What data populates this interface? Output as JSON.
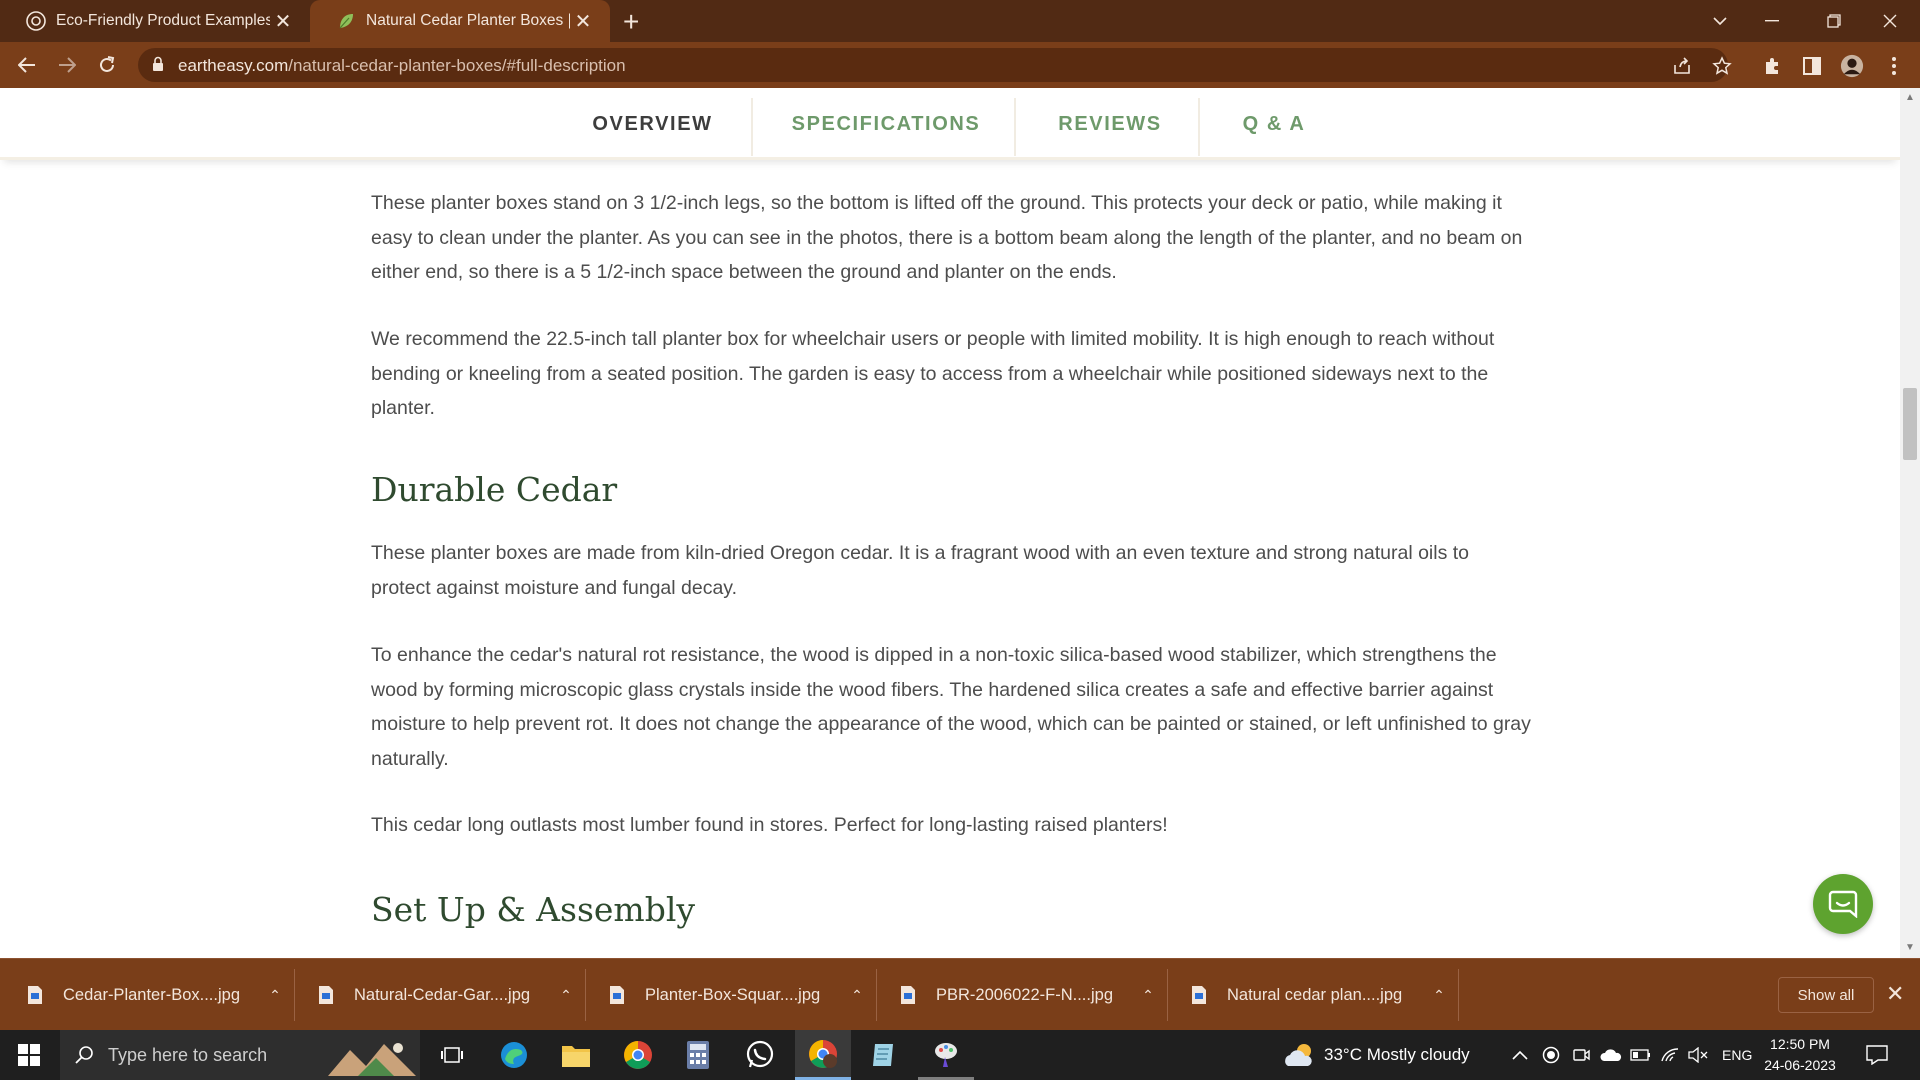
{
  "browser": {
    "tabs": [
      {
        "title": "Eco-Friendly Product Examples",
        "active": false
      },
      {
        "title": "Natural Cedar Planter Boxes | Ear",
        "active": true
      }
    ],
    "new_tab_symbol": "+",
    "close_symbol": "✕",
    "url_domain": "eartheasy.com",
    "url_path": "/natural-cedar-planter-boxes/#full-description"
  },
  "subnav": {
    "tabs": [
      {
        "label": "OVERVIEW",
        "active": true
      },
      {
        "label": "SPECIFICATIONS",
        "active": false
      },
      {
        "label": "REVIEWS",
        "active": false
      },
      {
        "label": "Q & A",
        "active": false
      }
    ]
  },
  "content": {
    "para1": "These planter boxes stand on 3 1/2-inch legs, so the bottom is lifted off the ground. This protects your deck or patio, while making it easy to clean under the planter. As you can see in the photos, there is a bottom beam along the length of the planter, and no beam on either end, so there is a 5 1/2-inch space between the ground and planter on the ends.",
    "para2": "We recommend the 22.5-inch tall planter box for wheelchair users or people with limited mobility. It is high enough to reach without bending or kneeling from a seated position. The garden is easy to access from a wheelchair while positioned sideways next to the planter.",
    "heading1": "Durable Cedar",
    "para3": "These planter boxes are made from kiln-dried Oregon cedar. It is a fragrant wood with an even texture and strong natural oils to protect against moisture and fungal decay.",
    "para4": "To enhance the cedar's natural rot resistance, the wood is dipped in a non-toxic silica-based wood stabilizer, which strengthens the wood by forming microscopic glass crystals inside the wood fibers. The hardened silica creates a safe and effective barrier against moisture to help prevent rot. It does not change the appearance of the wood, which can be painted or stained, or left unfinished to gray naturally.",
    "para5": "This cedar long outlasts most lumber found in stores. Perfect for long-lasting raised planters!",
    "heading2": "Set Up & Assembly"
  },
  "downloads": {
    "items": [
      {
        "name": "Cedar-Planter-Box....jpg"
      },
      {
        "name": "Natural-Cedar-Gar....jpg"
      },
      {
        "name": "Planter-Box-Squar....jpg"
      },
      {
        "name": "PBR-2006022-F-N....jpg"
      },
      {
        "name": "Natural cedar plan....jpg"
      }
    ],
    "show_all": "Show all"
  },
  "taskbar": {
    "search_placeholder": "Type here to search",
    "weather": "33°C  Mostly cloudy",
    "language": "ENG",
    "time": "12:50 PM",
    "date": "24-06-2023"
  },
  "colors": {
    "chrome_dark": "#512a14",
    "chrome": "#7a3e19",
    "subnav_green": "#6e9a6b",
    "heading_green": "#2f4a2f",
    "chat_green": "#5ea32f"
  }
}
